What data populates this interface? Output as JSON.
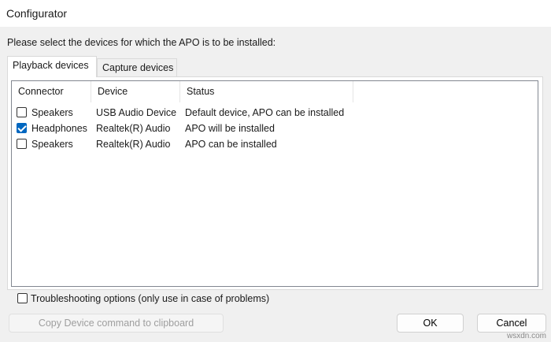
{
  "window": {
    "title": "Configurator"
  },
  "prompt": "Please select the devices for which the APO is to be installed:",
  "tabs": [
    {
      "label": "Playback devices",
      "active": true
    },
    {
      "label": "Capture devices",
      "active": false
    }
  ],
  "table": {
    "columns": [
      "Connector",
      "Device",
      "Status"
    ],
    "rows": [
      {
        "checked": false,
        "connector": "Speakers",
        "device": "USB Audio Device",
        "status": "Default device, APO can be installed"
      },
      {
        "checked": true,
        "connector": "Headphones",
        "device": "Realtek(R) Audio",
        "status": "APO will be installed"
      },
      {
        "checked": false,
        "connector": "Speakers",
        "device": "Realtek(R) Audio",
        "status": "APO can be installed"
      }
    ]
  },
  "troubleshooting": {
    "label": "Troubleshooting options (only use in case of problems)",
    "checked": false
  },
  "buttons": {
    "copy": "Copy Device command to clipboard",
    "ok": "OK",
    "cancel": "Cancel"
  },
  "watermark": "wsxdn.com",
  "colors": {
    "checkbox_checked": "#0067c0",
    "client_bg": "#f0f0f0"
  }
}
